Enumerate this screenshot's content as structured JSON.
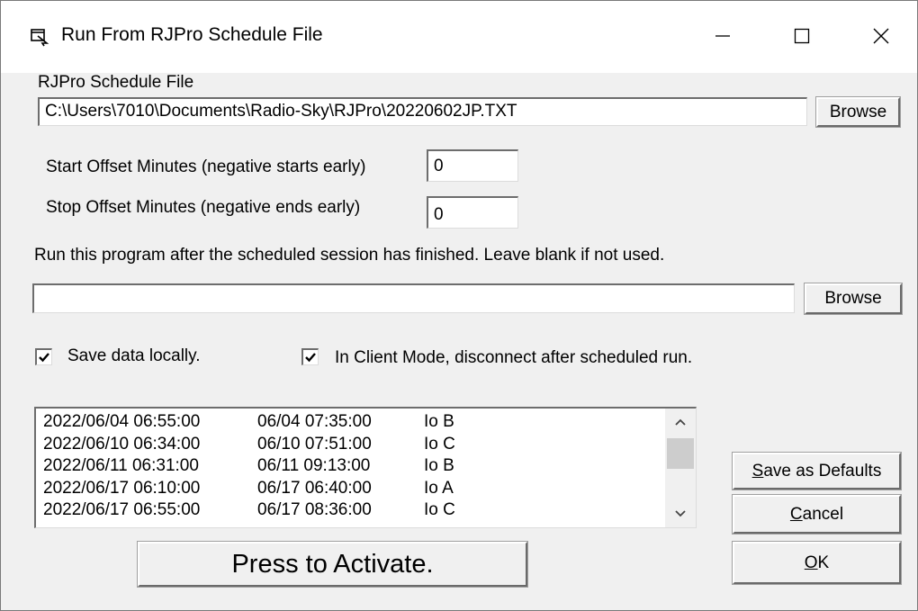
{
  "window": {
    "title": "Run From RJPro Schedule File",
    "icon": "app-window-icon",
    "controls": {
      "minimize": "minimize-icon",
      "maximize": "maximize-icon",
      "close": "close-icon"
    }
  },
  "schedule_file": {
    "label": "RJPro Schedule File",
    "value": "C:\\Users\\7010\\Documents\\Radio-Sky\\RJPro\\20220602JP.TXT",
    "browse_label": "Browse"
  },
  "start_offset": {
    "label": "Start Offset Minutes  (negative starts early)",
    "value": "0"
  },
  "stop_offset": {
    "label": "Stop Offset Minutes  (negative ends early)",
    "value": "0"
  },
  "after_program": {
    "label": "Run this program after the scheduled session has finished. Leave blank if not used.",
    "value": "",
    "browse_label": "Browse"
  },
  "save_locally": {
    "label": "Save data locally.",
    "checked": true
  },
  "client_disconnect": {
    "label": "In Client Mode, disconnect after scheduled run.",
    "checked": true
  },
  "schedule_list": {
    "rows": [
      {
        "start": "2022/06/04 06:55:00",
        "stop": "06/04 07:35:00",
        "target": "Io B"
      },
      {
        "start": "2022/06/10 06:34:00",
        "stop": "06/10 07:51:00",
        "target": "Io C"
      },
      {
        "start": "2022/06/11 06:31:00",
        "stop": "06/11 09:13:00",
        "target": "Io B"
      },
      {
        "start": "2022/06/17 06:10:00",
        "stop": "06/17 06:40:00",
        "target": "Io A"
      },
      {
        "start": "2022/06/17 06:55:00",
        "stop": "06/17 08:36:00",
        "target": "Io C"
      }
    ]
  },
  "buttons": {
    "save_defaults": {
      "accel": "S",
      "rest": "ave as Defaults"
    },
    "cancel": {
      "accel": "C",
      "rest": "ancel"
    },
    "ok": {
      "accel": "O",
      "rest": "K"
    },
    "activate": "Press to Activate."
  }
}
